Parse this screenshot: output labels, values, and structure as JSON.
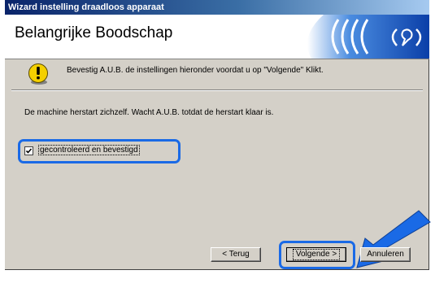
{
  "window": {
    "title": "Wizard instelling draadloos apparaat"
  },
  "header": {
    "title": "Belangrijke Boodschap"
  },
  "warning": {
    "text": "Bevestig A.U.B. de instellingen hieronder voordat u op \"Volgende\" Klikt."
  },
  "info": {
    "text": "De machine herstart zichzelf. Wacht A.U.B. totdat de herstart klaar is."
  },
  "checkbox": {
    "label": "gecontroleerd en bevestigd",
    "checked": true
  },
  "buttons": {
    "back": "< Terug",
    "next": "Volgende >",
    "cancel": "Annuleren"
  },
  "colors": {
    "highlight": "#1a6ae6",
    "titlebar": "#0a246a"
  }
}
